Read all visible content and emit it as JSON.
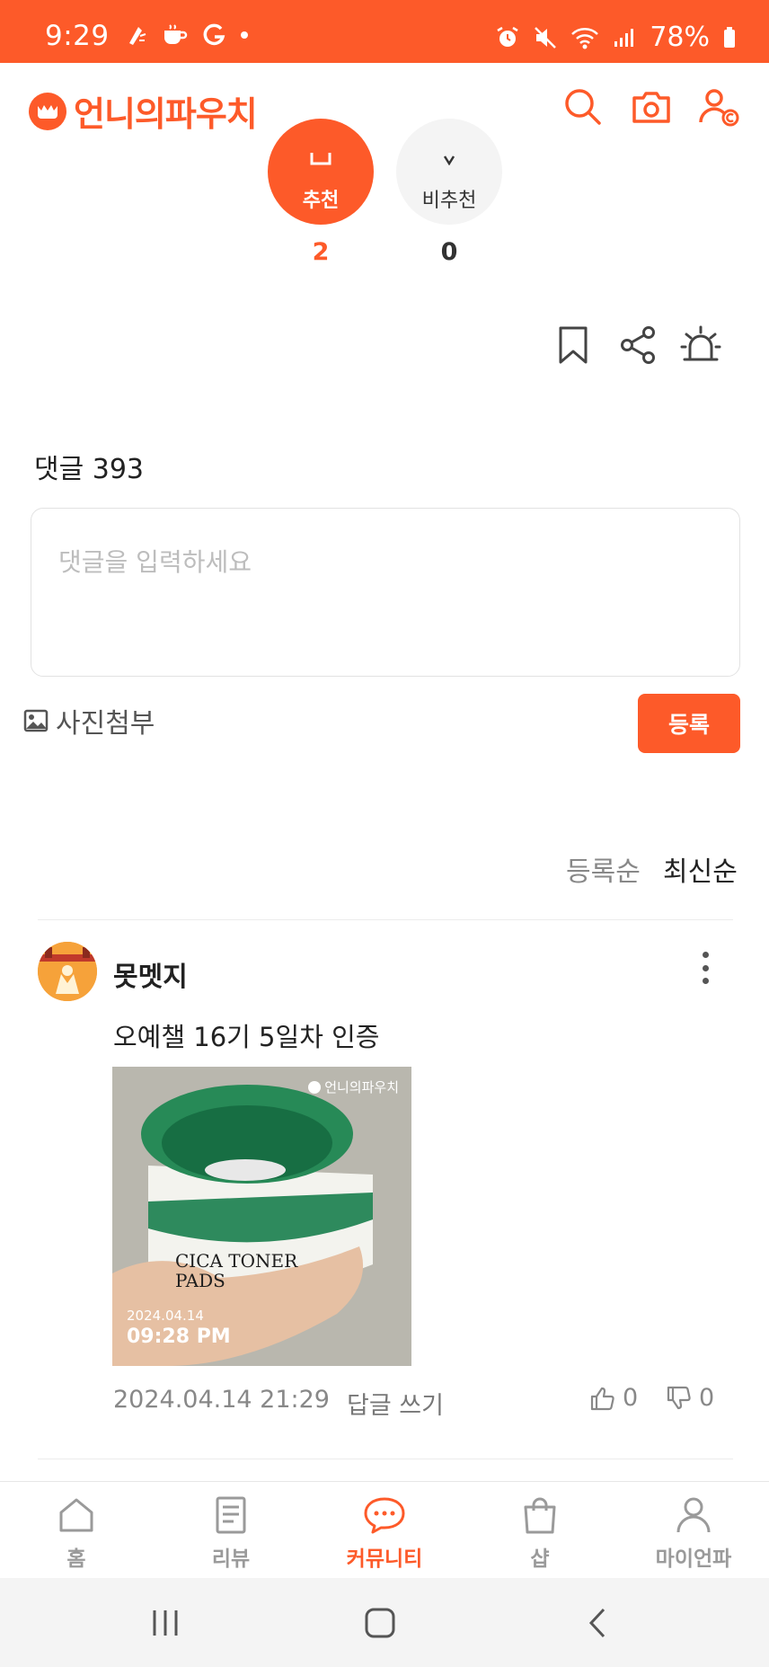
{
  "status_bar": {
    "time": "9:29",
    "battery": "78%",
    "icons_left": [
      "sparkle-icon",
      "coffee-icon",
      "g-icon",
      "dot"
    ],
    "icons_right": [
      "alarm-icon",
      "mute-icon",
      "wifi-icon",
      "signal-icon",
      "battery-icon"
    ]
  },
  "header": {
    "app_name": "언니의파우치",
    "icons": [
      "search-icon",
      "camera-icon",
      "profile-icon"
    ]
  },
  "vote": {
    "up_label": "추천",
    "up_count": "2",
    "down_label": "비추천",
    "down_count": "0"
  },
  "actions": [
    "bookmark-icon",
    "share-icon",
    "report-siren-icon"
  ],
  "comments": {
    "title": "댓글 393",
    "input_placeholder": "댓글을 입력하세요",
    "attach_label": "사진첨부",
    "submit_label": "등록",
    "sort_options": [
      "등록순",
      "최신순"
    ],
    "sort_selected": "최신순",
    "items": [
      {
        "author": "못멧지",
        "text": "오예챌 16기 5일차 인증",
        "photo": {
          "watermark": "언니의파우치",
          "stamp_date": "2024.04.14",
          "stamp_time": "09:28 PM",
          "product_text": "CICA TONER PADS"
        },
        "date": "2024.04.14 21:29",
        "reply_label": "답글 쓰기",
        "likes": "0",
        "dislikes": "0"
      }
    ]
  },
  "bottom_nav": {
    "items": [
      {
        "label": "홈",
        "icon": "home-icon"
      },
      {
        "label": "리뷰",
        "icon": "review-icon"
      },
      {
        "label": "커뮤니티",
        "icon": "community-chat-icon"
      },
      {
        "label": "샵",
        "icon": "shop-bag-icon"
      },
      {
        "label": "마이언파",
        "icon": "user-icon"
      }
    ],
    "active": "커뮤니티"
  },
  "colors": {
    "accent": "#fd5a29",
    "text": "#222222",
    "muted": "#888888"
  }
}
